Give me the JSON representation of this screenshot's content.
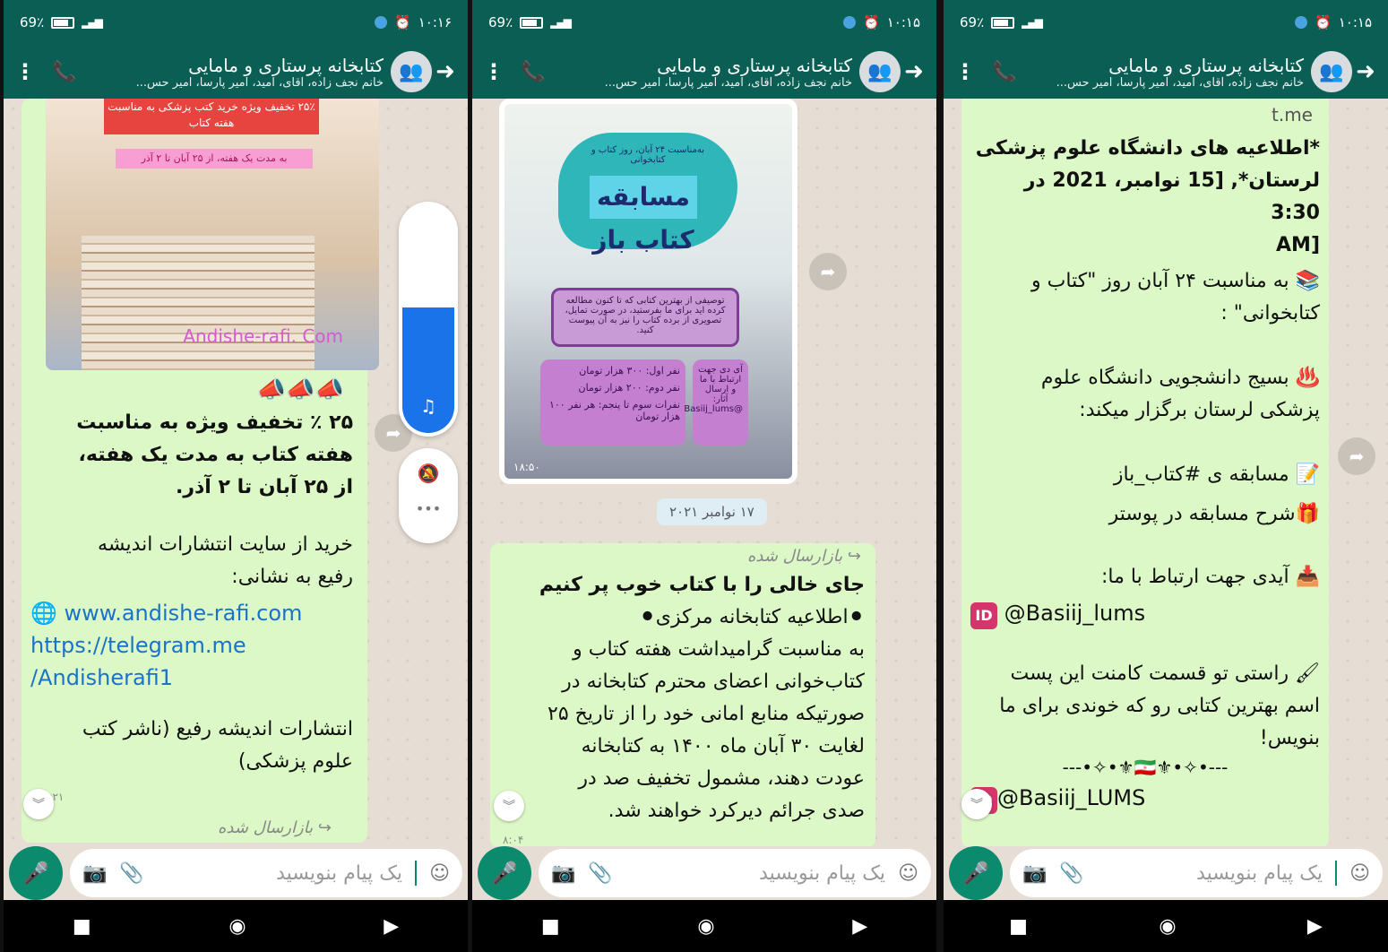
{
  "status": {
    "battery": "69٪",
    "screens": [
      {
        "time": "۱۰:۱۶"
      },
      {
        "time": "۱۰:۱۵"
      },
      {
        "time": "۱۰:۱۵"
      }
    ]
  },
  "header": {
    "title": "کتابخانه پرستاری و مامایی",
    "subtitle": "خانم نجف زاده، آقای، امید، امیر پارسا، امیر حس..."
  },
  "input": {
    "placeholder": "یک پیام بنویسید"
  },
  "screen1": {
    "poster": {
      "discount_banner": "۲۵٪ تخفیف ویژه خرید کتب پزشکی به مناسبت هفته کتاب",
      "date_banner": "به مدت یک هفته، از ۲۵ آبان تا ۲ آذر",
      "site": "Andishe-rafi. Com"
    },
    "emojis": "📣📣📣",
    "text1": "۲۵ ٪ تخفیف ویژه به مناسبت\nهفته کتاب به مدت یک هفته،\nاز ۲۵ آبان تا ۲ آذر.",
    "text2": "خرید از سایت انتشارات اندیشه\nرفیع به نشانی:",
    "link_web": "www.andishe-rafi.com",
    "link_tg": "https://telegram.me\n/Andisherafi1",
    "text3": "انتشارات اندیشه رفیع (ناشر کتب\nعلوم پزشکی)",
    "time": "۸:۲۱",
    "forwarded": "بازارسال شده"
  },
  "screen2": {
    "poster": {
      "subtitle": "به‌مناسبت ۲۴ آبان، روز کتاب و کتابخوانی",
      "title": "مسابقه کتاب باز",
      "box": "توصیفی از بهترین کتابی که تا کنون مطالعه کرده اید برای ما بفرستید، در صورت تمایل، تصویری از برده کتاب را نیز به آن پیوست کنید.",
      "prize1": "نفر اول: ۳۰۰ هزار تومان",
      "prize2": "نفر دوم: ۲۰۰ هزار تومان",
      "prize3": "نفرات سوم تا پنجم: هر نفر ۱۰۰ هزار تومان",
      "id_box": "آی دی جهت ارتباط با ما و ارسال آثار: @Basiij_lums",
      "time": "۱۸:۵۰"
    },
    "date_chip": "۱۷ نوامبر ۲۰۲۱",
    "forwarded": "بازارسال شده",
    "headline": "جای خالی را با کتاب خوب پر کنیم",
    "line2": "⚫اطلاعیه کتابخانه مرکزی⚫",
    "body": "به مناسبت گرامیداشت هفته کتاب و\nکتاب‌خوانی اعضای محترم کتابخانه در\nصورتیکه منابع امانی خود را از تاریخ ۲۵\nلغایت ۳۰ آبان ماه ۱۴۰۰ به کتابخانه\nعودت دهند، مشمول تخفیف صد در\nصدی جرائم دیرکرد خواهند شد.",
    "time": "۸:۰۴"
  },
  "screen3": {
    "tme": "t.me",
    "headline": "*اطلاعیه های دانشگاه علوم پزشکی\nلرستان*, [15 نوامبر، 2021 در 3:30\n[AM",
    "l1": "📚 به مناسبت ۲۴ آبان روز \"کتاب و\nکتابخوانی\" :",
    "l2": "♨️ بسیج دانشجویی دانشگاه علوم\nپزشکی لرستان برگزار میکند:",
    "l3": "📝 مسابقه ی #کتاب_باز",
    "l4": "🎁شرح مسابقه در پوستر",
    "l5": "📥 آیدی جهت ارتباط با ما:",
    "id1": "@Basiij_lums",
    "l6": "🖌 راستی تو قسمت کامنت این پست\nاسم بهترین کتابی رو که خوندی برای ما\nبنویس!",
    "decor": "---•✧•⚜🇮🇷⚜•✧•---",
    "id2": "@Basiij_LUMS",
    "id_badge": "ID"
  }
}
